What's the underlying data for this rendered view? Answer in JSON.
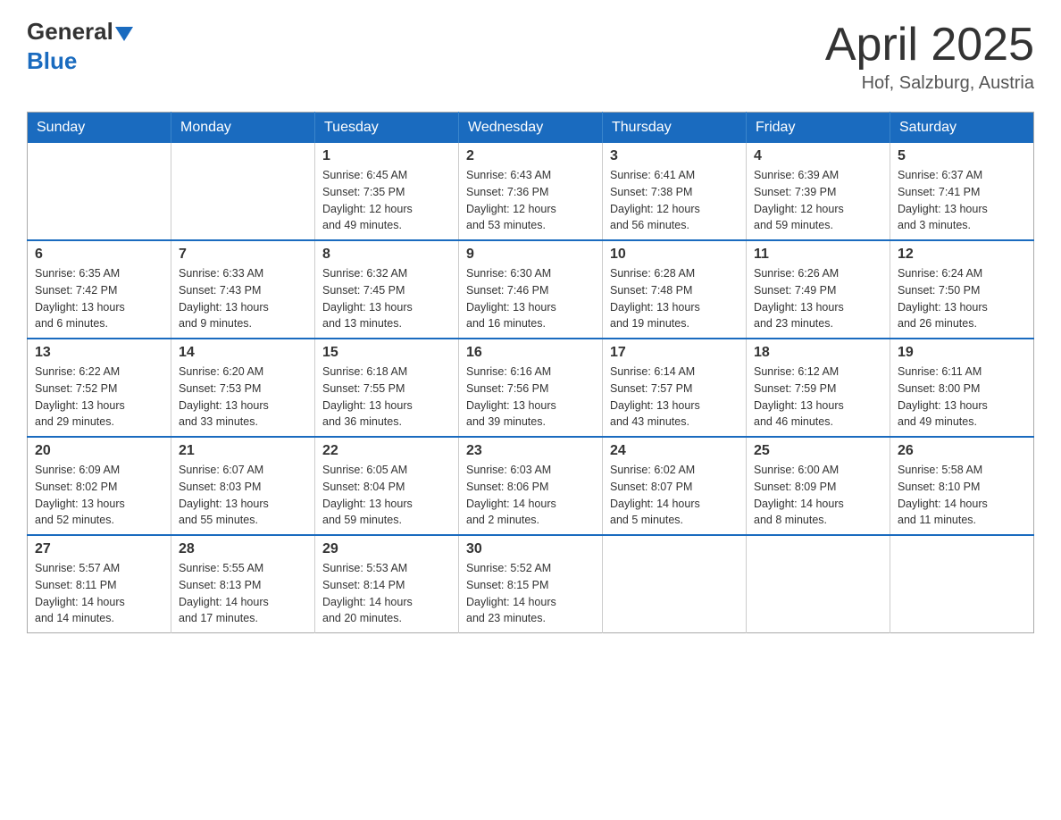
{
  "header": {
    "logo_general": "General",
    "logo_blue": "Blue",
    "month_title": "April 2025",
    "subtitle": "Hof, Salzburg, Austria"
  },
  "weekdays": [
    "Sunday",
    "Monday",
    "Tuesday",
    "Wednesday",
    "Thursday",
    "Friday",
    "Saturday"
  ],
  "weeks": [
    [
      {
        "day": "",
        "info": ""
      },
      {
        "day": "",
        "info": ""
      },
      {
        "day": "1",
        "info": "Sunrise: 6:45 AM\nSunset: 7:35 PM\nDaylight: 12 hours\nand 49 minutes."
      },
      {
        "day": "2",
        "info": "Sunrise: 6:43 AM\nSunset: 7:36 PM\nDaylight: 12 hours\nand 53 minutes."
      },
      {
        "day": "3",
        "info": "Sunrise: 6:41 AM\nSunset: 7:38 PM\nDaylight: 12 hours\nand 56 minutes."
      },
      {
        "day": "4",
        "info": "Sunrise: 6:39 AM\nSunset: 7:39 PM\nDaylight: 12 hours\nand 59 minutes."
      },
      {
        "day": "5",
        "info": "Sunrise: 6:37 AM\nSunset: 7:41 PM\nDaylight: 13 hours\nand 3 minutes."
      }
    ],
    [
      {
        "day": "6",
        "info": "Sunrise: 6:35 AM\nSunset: 7:42 PM\nDaylight: 13 hours\nand 6 minutes."
      },
      {
        "day": "7",
        "info": "Sunrise: 6:33 AM\nSunset: 7:43 PM\nDaylight: 13 hours\nand 9 minutes."
      },
      {
        "day": "8",
        "info": "Sunrise: 6:32 AM\nSunset: 7:45 PM\nDaylight: 13 hours\nand 13 minutes."
      },
      {
        "day": "9",
        "info": "Sunrise: 6:30 AM\nSunset: 7:46 PM\nDaylight: 13 hours\nand 16 minutes."
      },
      {
        "day": "10",
        "info": "Sunrise: 6:28 AM\nSunset: 7:48 PM\nDaylight: 13 hours\nand 19 minutes."
      },
      {
        "day": "11",
        "info": "Sunrise: 6:26 AM\nSunset: 7:49 PM\nDaylight: 13 hours\nand 23 minutes."
      },
      {
        "day": "12",
        "info": "Sunrise: 6:24 AM\nSunset: 7:50 PM\nDaylight: 13 hours\nand 26 minutes."
      }
    ],
    [
      {
        "day": "13",
        "info": "Sunrise: 6:22 AM\nSunset: 7:52 PM\nDaylight: 13 hours\nand 29 minutes."
      },
      {
        "day": "14",
        "info": "Sunrise: 6:20 AM\nSunset: 7:53 PM\nDaylight: 13 hours\nand 33 minutes."
      },
      {
        "day": "15",
        "info": "Sunrise: 6:18 AM\nSunset: 7:55 PM\nDaylight: 13 hours\nand 36 minutes."
      },
      {
        "day": "16",
        "info": "Sunrise: 6:16 AM\nSunset: 7:56 PM\nDaylight: 13 hours\nand 39 minutes."
      },
      {
        "day": "17",
        "info": "Sunrise: 6:14 AM\nSunset: 7:57 PM\nDaylight: 13 hours\nand 43 minutes."
      },
      {
        "day": "18",
        "info": "Sunrise: 6:12 AM\nSunset: 7:59 PM\nDaylight: 13 hours\nand 46 minutes."
      },
      {
        "day": "19",
        "info": "Sunrise: 6:11 AM\nSunset: 8:00 PM\nDaylight: 13 hours\nand 49 minutes."
      }
    ],
    [
      {
        "day": "20",
        "info": "Sunrise: 6:09 AM\nSunset: 8:02 PM\nDaylight: 13 hours\nand 52 minutes."
      },
      {
        "day": "21",
        "info": "Sunrise: 6:07 AM\nSunset: 8:03 PM\nDaylight: 13 hours\nand 55 minutes."
      },
      {
        "day": "22",
        "info": "Sunrise: 6:05 AM\nSunset: 8:04 PM\nDaylight: 13 hours\nand 59 minutes."
      },
      {
        "day": "23",
        "info": "Sunrise: 6:03 AM\nSunset: 8:06 PM\nDaylight: 14 hours\nand 2 minutes."
      },
      {
        "day": "24",
        "info": "Sunrise: 6:02 AM\nSunset: 8:07 PM\nDaylight: 14 hours\nand 5 minutes."
      },
      {
        "day": "25",
        "info": "Sunrise: 6:00 AM\nSunset: 8:09 PM\nDaylight: 14 hours\nand 8 minutes."
      },
      {
        "day": "26",
        "info": "Sunrise: 5:58 AM\nSunset: 8:10 PM\nDaylight: 14 hours\nand 11 minutes."
      }
    ],
    [
      {
        "day": "27",
        "info": "Sunrise: 5:57 AM\nSunset: 8:11 PM\nDaylight: 14 hours\nand 14 minutes."
      },
      {
        "day": "28",
        "info": "Sunrise: 5:55 AM\nSunset: 8:13 PM\nDaylight: 14 hours\nand 17 minutes."
      },
      {
        "day": "29",
        "info": "Sunrise: 5:53 AM\nSunset: 8:14 PM\nDaylight: 14 hours\nand 20 minutes."
      },
      {
        "day": "30",
        "info": "Sunrise: 5:52 AM\nSunset: 8:15 PM\nDaylight: 14 hours\nand 23 minutes."
      },
      {
        "day": "",
        "info": ""
      },
      {
        "day": "",
        "info": ""
      },
      {
        "day": "",
        "info": ""
      }
    ]
  ]
}
